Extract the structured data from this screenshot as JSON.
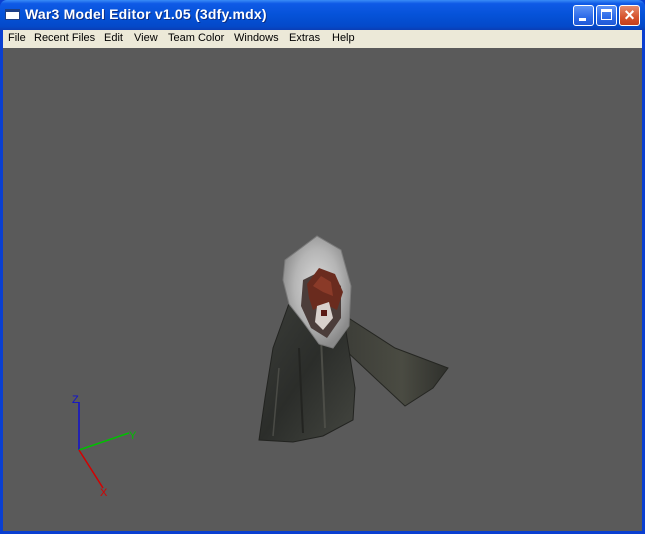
{
  "window": {
    "title": "War3 Model Editor v1.05 (3dfy.mdx)"
  },
  "menu": {
    "items": [
      {
        "label": "File"
      },
      {
        "label": "Recent Files"
      },
      {
        "label": "Edit"
      },
      {
        "label": "View"
      },
      {
        "label": "Team Color"
      },
      {
        "label": "Windows"
      },
      {
        "label": "Extras"
      },
      {
        "label": "Help"
      }
    ]
  },
  "viewport": {
    "background": "#5a5a5a",
    "axes": {
      "x_label": "X",
      "y_label": "Y",
      "z_label": "Z",
      "x_color": "#d40000",
      "y_color": "#00c000",
      "z_color": "#1010d0"
    }
  },
  "icons": [
    "app-window-icon",
    "minimize-icon",
    "maximize-icon",
    "close-icon"
  ]
}
